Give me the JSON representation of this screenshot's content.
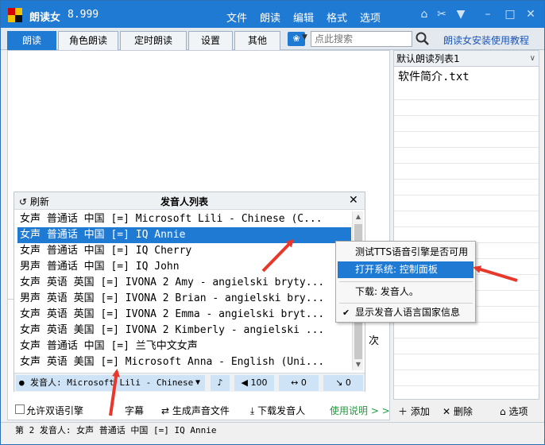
{
  "titlebar": {
    "app_name": "朗读女",
    "version": "8.999",
    "menus": [
      "文件",
      "朗读",
      "编辑",
      "格式",
      "选项"
    ],
    "icons": [
      "home-icon",
      "tools-icon",
      "shirt-icon",
      "minimize-icon",
      "maximize-icon",
      "close-icon"
    ]
  },
  "tabs": [
    "朗读",
    "角色朗读",
    "定时朗读",
    "设置",
    "其他"
  ],
  "search": {
    "placeholder": "点此搜索"
  },
  "help_link": "朗读女安装使用教程",
  "right_panel": {
    "list_name": "默认朗读列表1",
    "items": [
      "软件简介.txt"
    ],
    "buttons": {
      "add": "添加",
      "delete": "删除",
      "options": "选项"
    }
  },
  "voice_panel": {
    "refresh": "刷新",
    "title": "发音人列表",
    "rows": [
      "女声 普通话 中国 [=] Microsoft Lili - Chinese (C...",
      "女声 普通话 中国 [=] IQ Annie",
      "女声 普通话 中国 [=] IQ Cherry",
      "男声 普通话 中国 [=] IQ John",
      "女声 英语 英国 [=] IVONA 2 Amy - angielski bryty...",
      "男声 英语 英国 [=] IVONA 2 Brian - angielski bry...",
      "女声 英语 英国 [=] IVONA 2 Emma - angielski bryt...",
      "女声 英语 美国 [=] IVONA 2 Kimberly - angielski ...",
      "女声 普通话 中国 [=] 兰飞中文女声",
      "女声 英语 美国 [=] Microsoft Anna - English (Uni..."
    ],
    "selected_index": 1,
    "bar": {
      "voice_label": "发音人: Microsoft Lili - Chinese",
      "volume": "100",
      "speed": "0",
      "pitch": "0"
    }
  },
  "context_menu": {
    "items": [
      "测试TTS语音引擎是否可用",
      "打开系统: 控制面板",
      "下载: 发音人。",
      "显示发音人语言国家信息"
    ],
    "highlighted_index": 1,
    "checked_index": 3
  },
  "editor_side_label": "次",
  "bottom_bar": {
    "allow_dual": "允许双语引擎",
    "subtitle": "字幕",
    "generate_audio": "生成声音文件",
    "download_voice": "下载发音人",
    "usage": "使用说明 > >"
  },
  "status": "第 2 发音人: 女声 普通话 中国 [=] IQ Annie",
  "colors": {
    "accent": "#1f7ad4",
    "link": "#1a56b8",
    "usage_green": "#1a9c3a",
    "arrow_red": "#e8382c"
  }
}
